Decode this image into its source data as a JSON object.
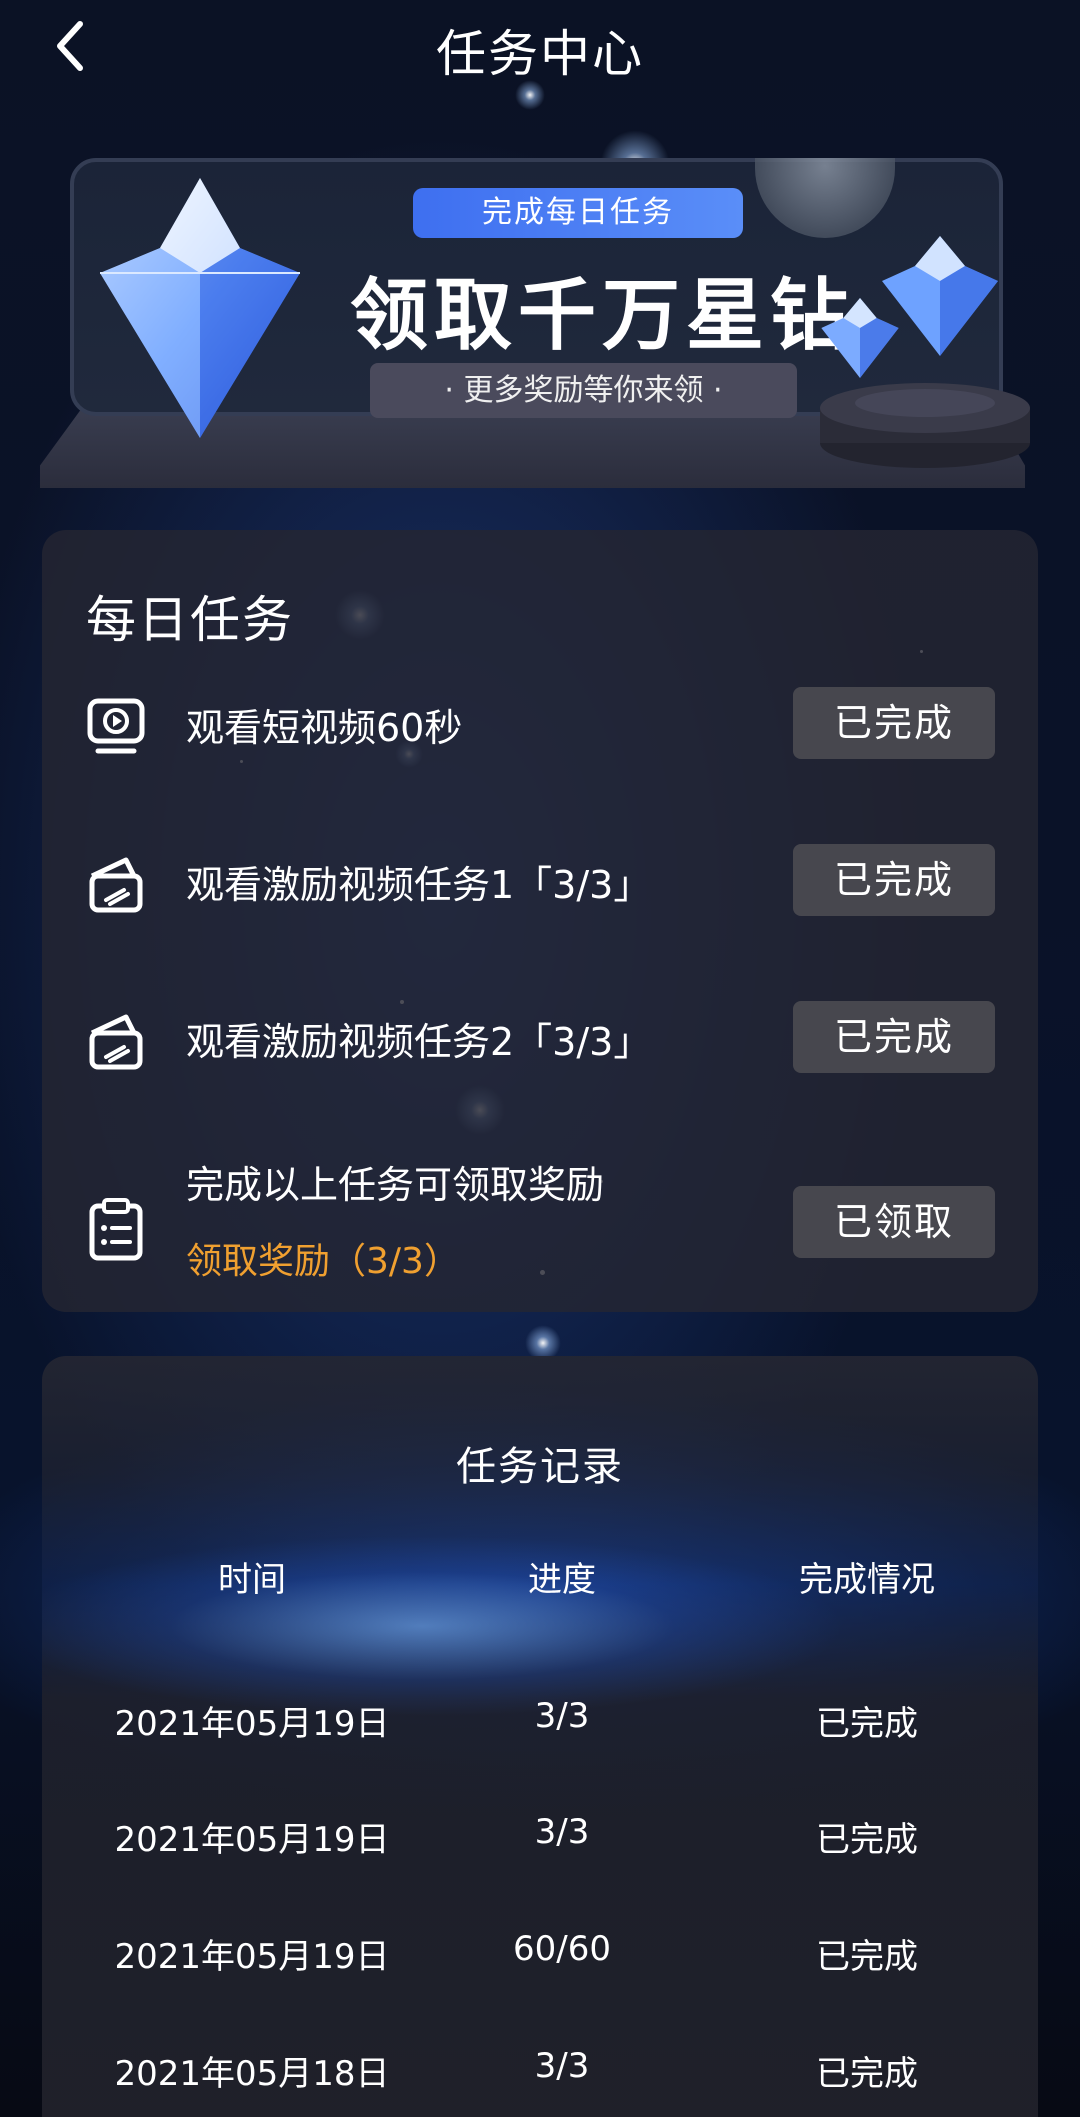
{
  "header": {
    "title": "任务中心"
  },
  "banner": {
    "tag": "完成每日任务",
    "headline": "领取千万星钻",
    "subline": "· 更多奖励等你来领 ·"
  },
  "daily": {
    "title": "每日任务",
    "tasks": [
      {
        "name": "观看短视频60秒",
        "button": "已完成",
        "icon": "video-play-icon"
      },
      {
        "name": "观看激励视频任务1「3/3」",
        "button": "已完成",
        "icon": "video-card-icon"
      },
      {
        "name": "观看激励视频任务2「3/3」",
        "button": "已完成",
        "icon": "video-card-icon"
      },
      {
        "name": "完成以上任务可领取奖励",
        "sub": "领取奖励（3/3）",
        "button": "已领取",
        "icon": "clipboard-icon"
      }
    ]
  },
  "records": {
    "title": "任务记录",
    "columns": [
      "时间",
      "进度",
      "完成情况"
    ],
    "rows": [
      {
        "time": "2021年05月19日",
        "progress": "3/3",
        "status": "已完成"
      },
      {
        "time": "2021年05月19日",
        "progress": "3/3",
        "status": "已完成"
      },
      {
        "time": "2021年05月19日",
        "progress": "60/60",
        "status": "已完成"
      },
      {
        "time": "2021年05月18日",
        "progress": "3/3",
        "status": "已完成"
      }
    ]
  },
  "colors": {
    "accent_blue": "#4a7ff5",
    "reward_orange": "#f0a030",
    "button_gray": "#47474e"
  }
}
